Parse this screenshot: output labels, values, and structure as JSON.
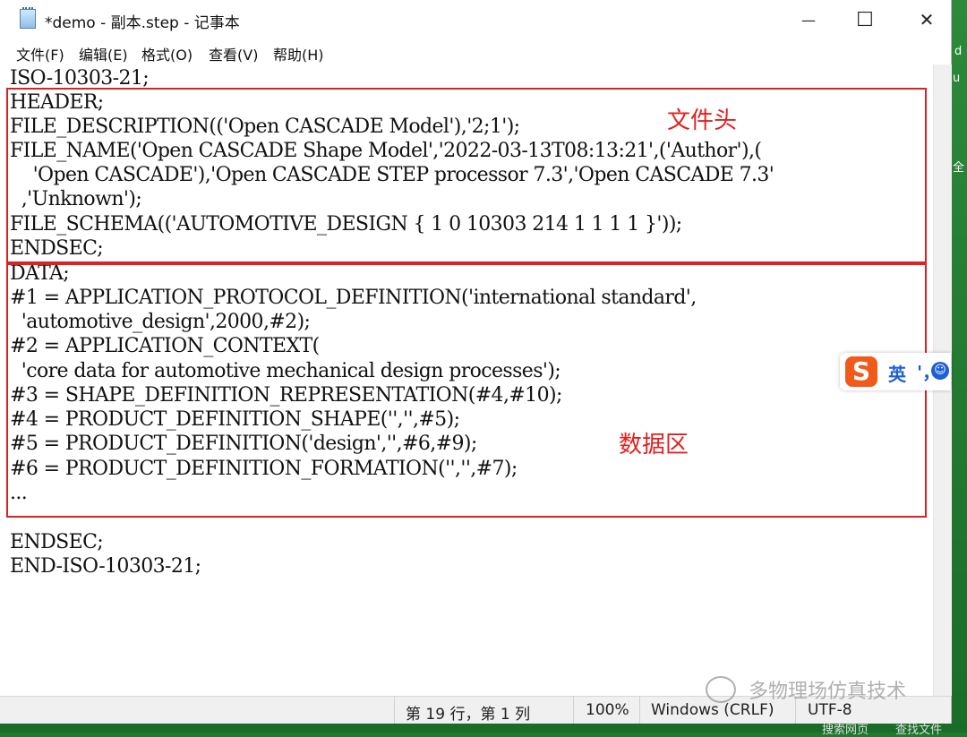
{
  "window": {
    "title": "*demo - 副本.step - 记事本",
    "minimize_glyph": "—",
    "maximize_glyph": "☐",
    "close_glyph": "✕"
  },
  "menu": {
    "items": [
      "文件(F)",
      "编辑(E)",
      "格式(O)",
      "查看(V)",
      "帮助(H)"
    ]
  },
  "editor": {
    "lines": [
      "ISO-10303-21;",
      "HEADER;",
      "FILE_DESCRIPTION(('Open CASCADE Model'),'2;1');",
      "FILE_NAME('Open CASCADE Shape Model','2022-03-13T08:13:21',('Author'),(",
      "    'Open CASCADE'),'Open CASCADE STEP processor 7.3','Open CASCADE 7.3'",
      "  ,'Unknown');",
      "FILE_SCHEMA(('AUTOMOTIVE_DESIGN { 1 0 10303 214 1 1 1 1 }'));",
      "ENDSEC;",
      "DATA;",
      "#1 = APPLICATION_PROTOCOL_DEFINITION('international standard',",
      "  'automotive_design',2000,#2);",
      "#2 = APPLICATION_CONTEXT(",
      "  'core data for automotive mechanical design processes');",
      "#3 = SHAPE_DEFINITION_REPRESENTATION(#4,#10);",
      "#4 = PRODUCT_DEFINITION_SHAPE('','',#5);",
      "#5 = PRODUCT_DEFINITION('design','',#6,#9);",
      "#6 = PRODUCT_DEFINITION_FORMATION('','',#7);",
      "...",
      "",
      "ENDSEC;",
      "END-ISO-10303-21;"
    ]
  },
  "annotations": {
    "header_label": "文件头",
    "data_label": "数据区",
    "box_color": "#e02020"
  },
  "ime": {
    "logo": "S",
    "mode": "英",
    "punct": "'，",
    "emoji_icon": "smile-icon"
  },
  "status": {
    "position": "第 19 行，第 1 列",
    "zoom": "100%",
    "line_ending": "Windows (CRLF)",
    "encoding": "UTF-8"
  },
  "watermark": {
    "text": "多物理场仿真技术"
  },
  "taskbar": {
    "search_text": "搜索网页",
    "find_text": "查找文件"
  }
}
